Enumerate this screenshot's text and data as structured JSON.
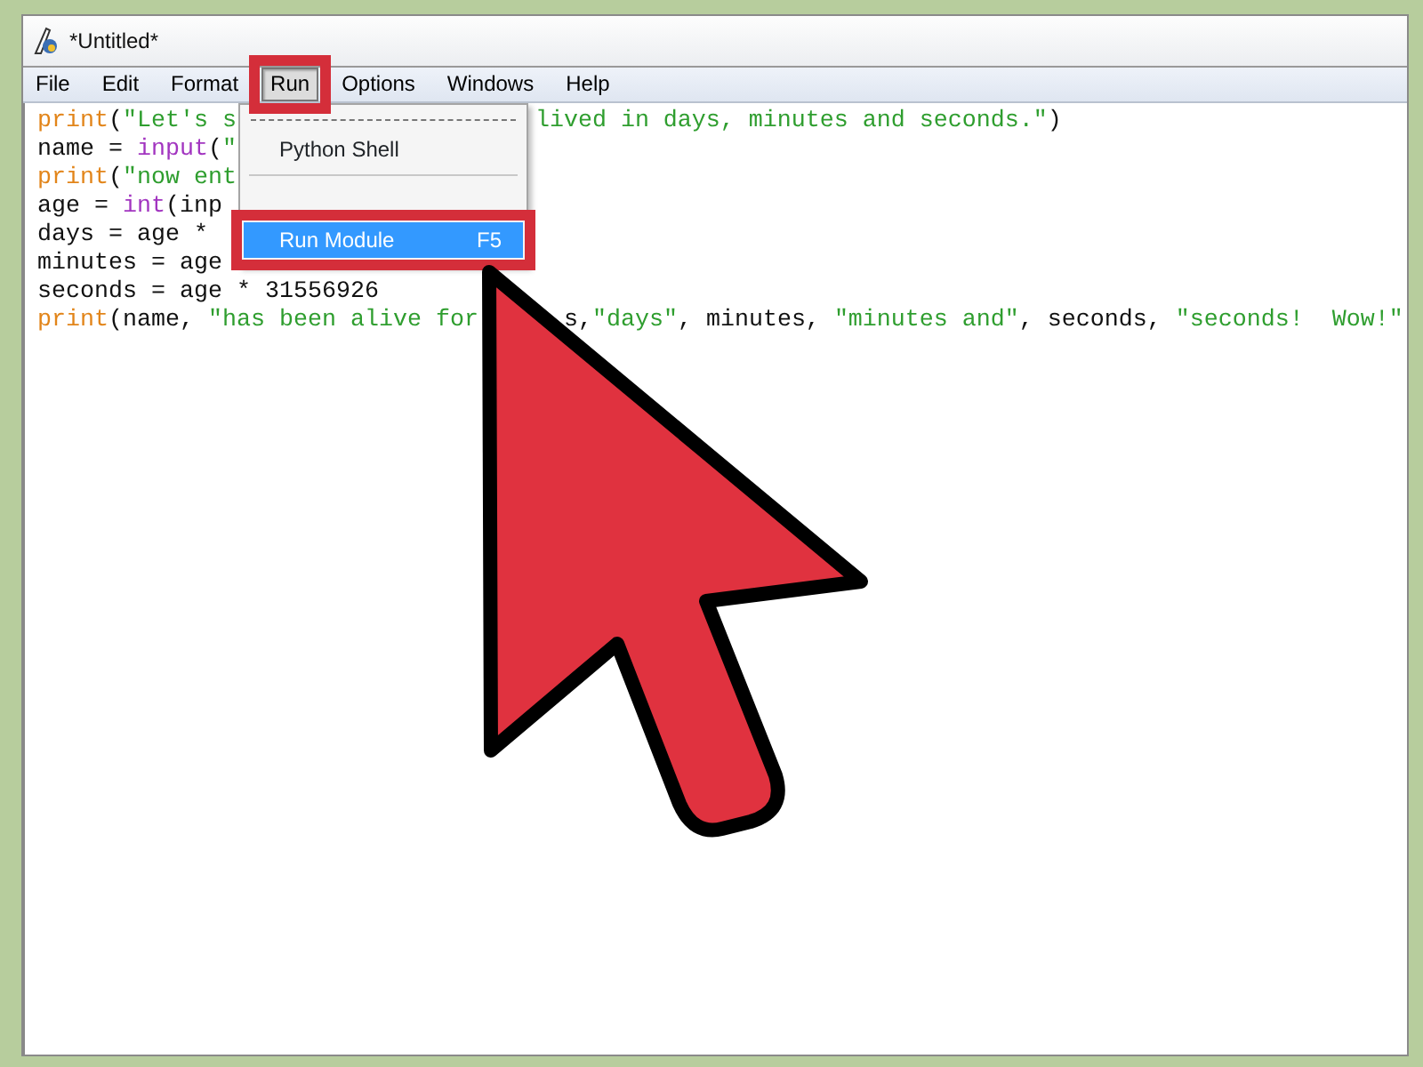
{
  "window": {
    "title": "*Untitled*"
  },
  "menu_bar": [
    {
      "label": "File",
      "selected": false
    },
    {
      "label": "Edit",
      "selected": false
    },
    {
      "label": "Format",
      "selected": false
    },
    {
      "label": "Run",
      "selected": true
    },
    {
      "label": "Options",
      "selected": false
    },
    {
      "label": "Windows",
      "selected": false
    },
    {
      "label": "Help",
      "selected": false
    }
  ],
  "run_menu": {
    "items": [
      {
        "kind": "tearoff"
      },
      {
        "kind": "item",
        "label": "Python Shell",
        "selected": false
      },
      {
        "kind": "separator"
      },
      {
        "kind": "item",
        "label": "Run Module",
        "shortcut": "F5",
        "selected": true
      }
    ]
  },
  "editor": {
    "lines": [
      {
        "left": [
          {
            "kind": "keyword",
            "text": "print"
          },
          {
            "kind": "plain",
            "text": "("
          },
          {
            "kind": "string",
            "text": "\"Let's s"
          }
        ],
        "right": [
          {
            "kind": "string",
            "text": "lived in days, minutes and seconds.\""
          },
          {
            "kind": "plain",
            "text": ")"
          }
        ]
      },
      {
        "left": [
          {
            "kind": "plain",
            "text": "name = "
          },
          {
            "kind": "builtin",
            "text": "input"
          },
          {
            "kind": "plain",
            "text": "("
          },
          {
            "kind": "string",
            "text": "\""
          }
        ]
      },
      {
        "left": [
          {
            "kind": "keyword",
            "text": "print"
          },
          {
            "kind": "plain",
            "text": "("
          },
          {
            "kind": "string",
            "text": "\"now ent"
          }
        ]
      },
      {
        "left": [
          {
            "kind": "plain",
            "text": "age = "
          },
          {
            "kind": "builtin",
            "text": "int"
          },
          {
            "kind": "plain",
            "text": "(inp"
          }
        ]
      },
      {
        "left": [
          {
            "kind": "plain",
            "text": "days = age *"
          }
        ]
      },
      {
        "left": [
          {
            "kind": "plain",
            "text": "minutes = age"
          }
        ]
      },
      {
        "left": [
          {
            "kind": "plain",
            "text": "seconds = age * 31556926"
          }
        ]
      },
      {
        "left": [
          {
            "kind": "keyword",
            "text": "print"
          },
          {
            "kind": "plain",
            "text": "(name, "
          },
          {
            "kind": "string",
            "text": "\"has been alive for"
          }
        ],
        "right": [
          {
            "kind": "plain",
            "text": "s,"
          },
          {
            "kind": "string",
            "text": "\"days\""
          },
          {
            "kind": "plain",
            "text": ", minutes, "
          },
          {
            "kind": "string",
            "text": "\"minutes and\""
          },
          {
            "kind": "plain",
            "text": ", seconds, "
          },
          {
            "kind": "string",
            "text": "\"seconds!  Wow!\""
          }
        ]
      }
    ]
  }
}
